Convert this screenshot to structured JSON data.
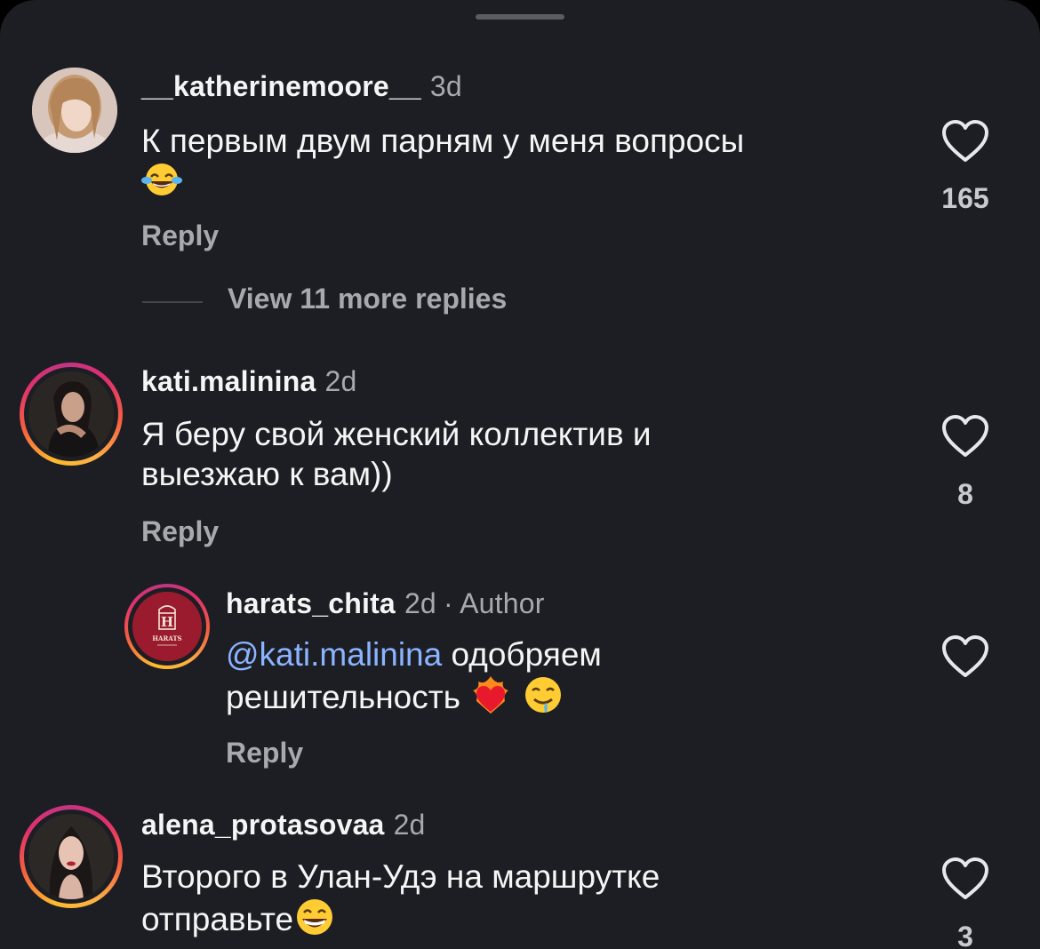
{
  "comments": [
    {
      "username": "__katherinemoore__",
      "time": "3d",
      "text_line1": "К первым двум парням у меня вопросы",
      "emoji": "face-with-tears-of-joy",
      "reply_label": "Reply",
      "likes": "165",
      "view_more": "View 11 more replies"
    },
    {
      "username": "kati.malinina",
      "time": "2d",
      "text_line1": "Я беру свой женский коллектив и",
      "text_line2": "выезжаю к вам))",
      "reply_label": "Reply",
      "likes": "8"
    },
    {
      "username": "harats_chita",
      "time": "2d",
      "author_badge": "· Author",
      "mention": "@kati.malinina",
      "text_line1": " одобряем",
      "text_line2": "решительность",
      "emojis": [
        "heart-on-fire",
        "drooling-face"
      ],
      "reply_label": "Reply",
      "avatar_logo_letter": "H",
      "avatar_logo_text": "HARATS"
    },
    {
      "username": "alena_protasovaa",
      "time": "2d",
      "text_line1": "Второго в Улан-Удэ на маршрутке",
      "text_line2": "отправьте",
      "emoji": "grinning-face",
      "likes": "3"
    }
  ],
  "colors": {
    "background": "#1d1e24",
    "text": "#f5f5f5",
    "secondary": "#a8a8ad",
    "mention": "#8ab4ff",
    "brand_red": "#9b1b2e"
  }
}
